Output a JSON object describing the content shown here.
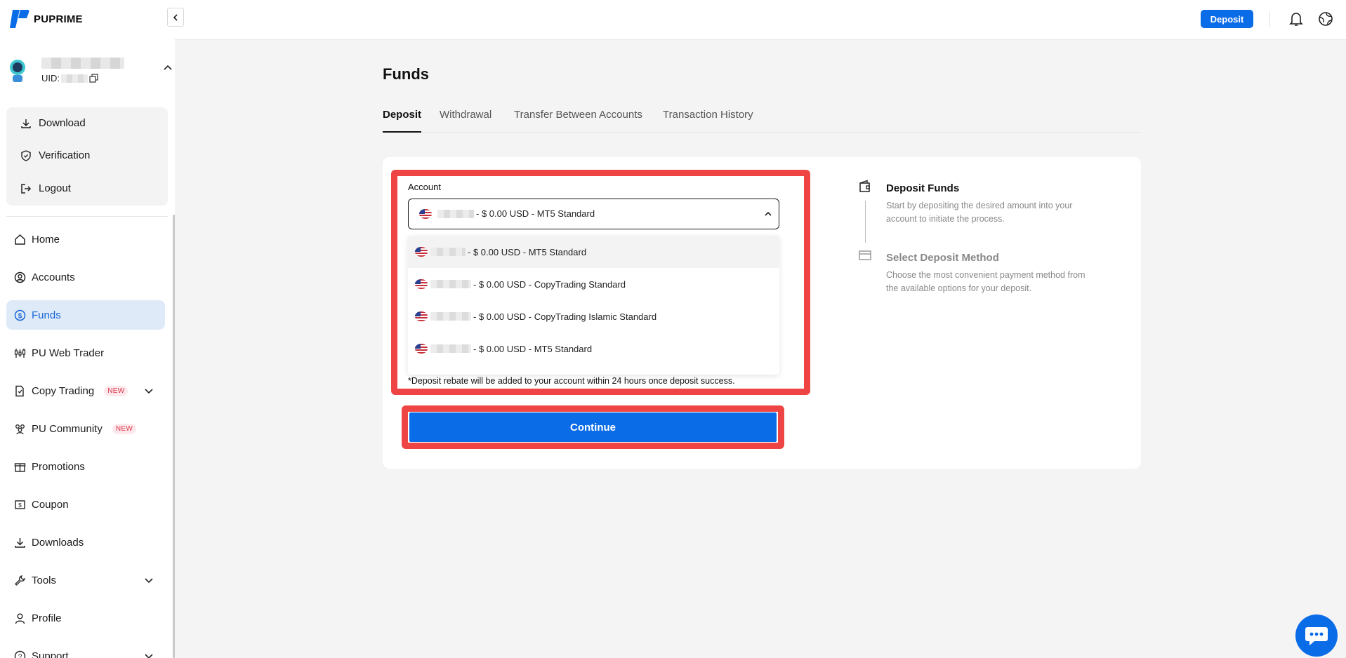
{
  "brand": {
    "name": "PUPRIME"
  },
  "user": {
    "uid_label": "UID:"
  },
  "account_menu": [
    {
      "label": "Download",
      "icon": "download-icon"
    },
    {
      "label": "Verification",
      "icon": "shield-check-icon"
    },
    {
      "label": "Logout",
      "icon": "logout-icon"
    }
  ],
  "nav": [
    {
      "label": "Home",
      "icon": "home-icon"
    },
    {
      "label": "Accounts",
      "icon": "user-circle-icon"
    },
    {
      "label": "Funds",
      "icon": "dollar-circle-icon",
      "active": true
    },
    {
      "label": "PU Web Trader",
      "icon": "candlestick-icon"
    },
    {
      "label": "Copy Trading",
      "icon": "copy-document-icon",
      "badge": "NEW",
      "expandable": true
    },
    {
      "label": "PU Community",
      "icon": "people-icon",
      "badge": "NEW"
    },
    {
      "label": "Promotions",
      "icon": "gift-icon"
    },
    {
      "label": "Coupon",
      "icon": "coupon-icon"
    },
    {
      "label": "Downloads",
      "icon": "download-icon"
    },
    {
      "label": "Tools",
      "icon": "wrench-icon",
      "expandable": true
    },
    {
      "label": "Profile",
      "icon": "person-icon"
    },
    {
      "label": "Support",
      "icon": "help-circle-icon",
      "expandable": true
    }
  ],
  "topbar": {
    "deposit_label": "Deposit"
  },
  "page": {
    "title": "Funds",
    "tabs": [
      {
        "label": "Deposit",
        "active": true
      },
      {
        "label": "Withdrawal"
      },
      {
        "label": "Transfer Between Accounts"
      },
      {
        "label": "Transaction History"
      }
    ]
  },
  "deposit_form": {
    "account_label": "Account",
    "selected_value": "- $ 0.00 USD - MT5 Standard",
    "options": [
      "- $ 0.00 USD - MT5 Standard",
      "- $ 0.00 USD - CopyTrading Standard",
      "- $ 0.00 USD - CopyTrading Islamic Standard",
      "- $ 0.00 USD - MT5 Standard"
    ],
    "rebate_note": "*Deposit rebate will be added to your account within 24 hours once deposit success.",
    "continue_label": "Continue"
  },
  "steps": [
    {
      "title": "Deposit Funds",
      "desc": "Start by depositing the desired amount into your account to initiate the process."
    },
    {
      "title": "Select Deposit Method",
      "desc": "Choose the most convenient payment method from the available options for your deposit."
    }
  ],
  "colors": {
    "accent": "#0b6ce8",
    "highlight": "#ef4444",
    "active_nav_bg": "#dfeaf8",
    "badge_red": "#e0334a"
  }
}
